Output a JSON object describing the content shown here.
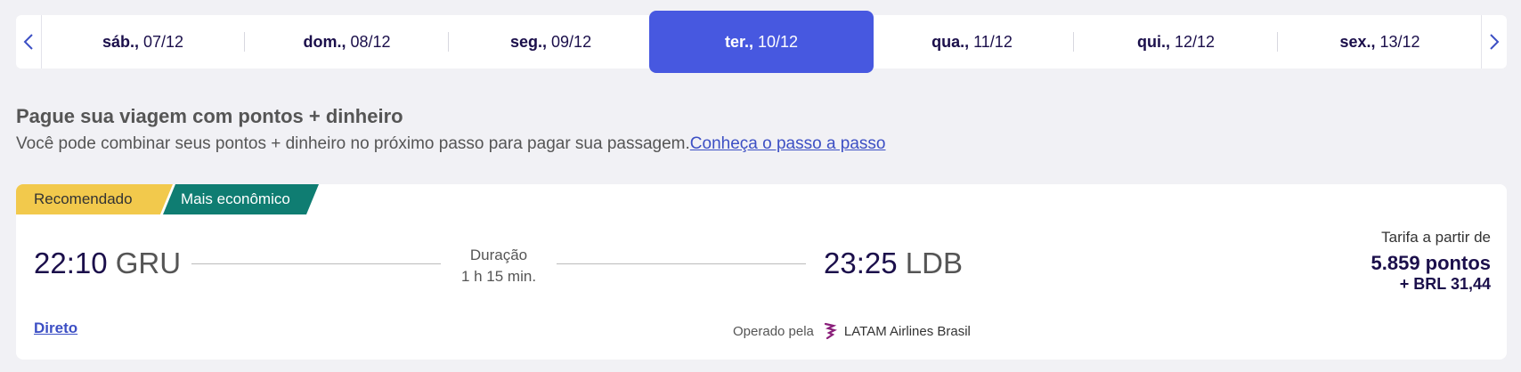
{
  "dates": [
    {
      "day": "sáb.,",
      "date": "07/12"
    },
    {
      "day": "dom.,",
      "date": "08/12"
    },
    {
      "day": "seg.,",
      "date": "09/12"
    },
    {
      "day": "ter.,",
      "date": "10/12"
    },
    {
      "day": "qua.,",
      "date": "11/12"
    },
    {
      "day": "qui.,",
      "date": "12/12"
    },
    {
      "day": "sex.,",
      "date": "13/12"
    }
  ],
  "promo": {
    "title": "Pague sua viagem com pontos + dinheiro",
    "description": "Você pode combinar seus pontos + dinheiro no próximo passo para pagar sua passagem.",
    "link": "Conheça o passo a passo"
  },
  "flight": {
    "tag_recommended": "Recomendado",
    "tag_economic": "Mais econômico",
    "departure_time": "22:10",
    "departure_code": "GRU",
    "arrival_time": "23:25",
    "arrival_code": "LDB",
    "duration_label": "Duração",
    "duration": "1 h 15 min.",
    "fare_label": "Tarifa a partir de",
    "fare_points": "5.859 pontos",
    "fare_money": "+ BRL 31,44",
    "direct": "Direto",
    "operated_by": "Operado pela",
    "airline": "LATAM Airlines Brasil"
  },
  "colors": {
    "active_date": "#4758e0",
    "tag_recommended": "#f2c94c",
    "tag_economic": "#0f7d72",
    "text_dark": "#1b0f4b",
    "link": "#3c4fc4"
  }
}
